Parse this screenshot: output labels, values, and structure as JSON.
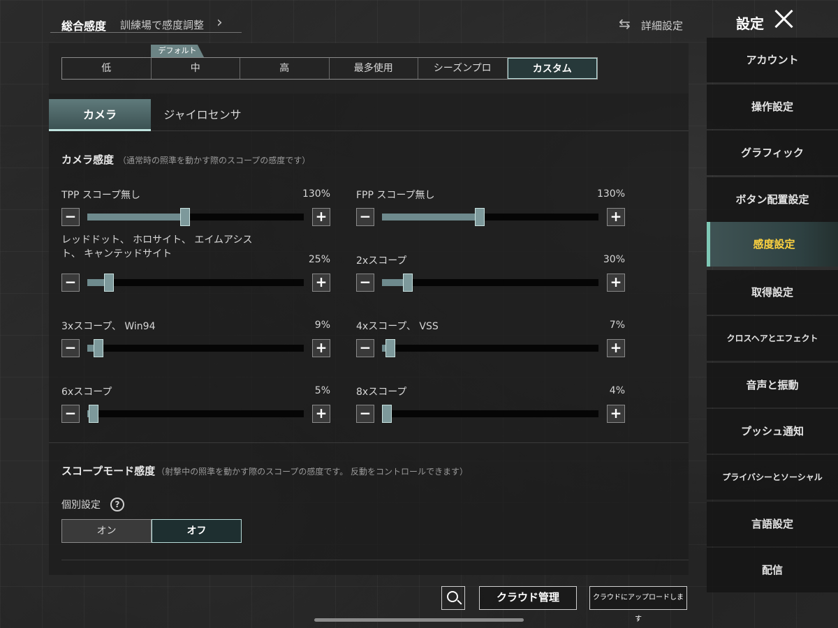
{
  "header": {
    "title": "総合感度",
    "sub_link": "訓練場で感度調整",
    "advanced_label": "詳細設定",
    "settings_title": "設定"
  },
  "presets": {
    "default_tag": "デフォルト",
    "items": [
      "低",
      "中",
      "高",
      "最多使用",
      "シーズンプロ",
      "カスタム"
    ],
    "selected": "カスタム"
  },
  "tabs": [
    "カメラ",
    "ジャイロセンサ"
  ],
  "camera_section": {
    "title": "カメラ感度",
    "note": "（通常時の照準を動かす際のスコープの感度です）"
  },
  "sliders": [
    {
      "label": "TPP スコープ無し",
      "value": "130%",
      "level": 0.45
    },
    {
      "label": "FPP スコープ無し",
      "value": "130%",
      "level": 0.45
    },
    {
      "label": "レッドドット、 ホロサイト、 エイムアシスト、 キャンテッドサイト",
      "value": "25%",
      "level": 0.1
    },
    {
      "label": "2xスコープ",
      "value": "30%",
      "level": 0.12
    },
    {
      "label": "3xスコープ、 Win94",
      "value": "9%",
      "level": 0.05
    },
    {
      "label": "4xスコープ、 VSS",
      "value": "7%",
      "level": 0.04
    },
    {
      "label": "6xスコープ",
      "value": "5%",
      "level": 0.03
    },
    {
      "label": "8xスコープ",
      "value": "4%",
      "level": 0.02
    }
  ],
  "scope_section": {
    "title": "スコープモード感度",
    "note": "（射撃中の照準を動かす際のスコープの感度です。 反動をコントロールできます）",
    "individual_label": "個別設定",
    "help_glyph": "?",
    "on_label": "オン",
    "off_label": "オフ",
    "selected": "オフ"
  },
  "footer": {
    "cloud_label": "クラウド管理",
    "upload_label": "クラウドにアップロードします"
  },
  "sidebar": {
    "items": [
      "アカウント",
      "操作設定",
      "グラフィック",
      "ボタン配置設定",
      "感度設定",
      "取得設定",
      "クロスヘアとエフェクト",
      "音声と振動",
      "プッシュ通知",
      "プライバシーとソーシャル",
      "言語設定",
      "配信"
    ],
    "active": "感度設定"
  },
  "colors": {
    "accent_teal": "#b8dcd9",
    "active_text": "#ffd33f",
    "slider_fill": "#6e8a8d"
  },
  "icons": {
    "chevron": "chevron-right-icon",
    "advanced": "swap-arrows-icon",
    "close": "close-icon",
    "search": "search-icon",
    "help": "help-circle-icon"
  }
}
